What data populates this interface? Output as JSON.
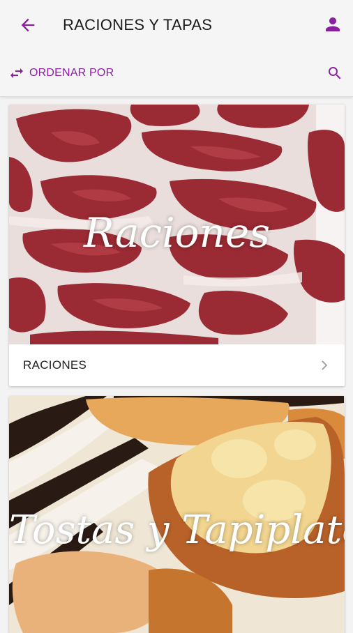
{
  "header": {
    "title": "RACIONES Y TAPAS",
    "back_icon": "arrow-back-icon",
    "profile_icon": "person-icon"
  },
  "toolbar": {
    "sort_label": "ORDENAR POR",
    "sort_icon": "swap-arrows-icon",
    "search_icon": "search-icon"
  },
  "colors": {
    "accent": "#8a1fa0"
  },
  "categories": [
    {
      "image_text": "Raciones",
      "label": "RACIONES"
    },
    {
      "image_text": "Tostas y Tapiplatos"
    }
  ]
}
